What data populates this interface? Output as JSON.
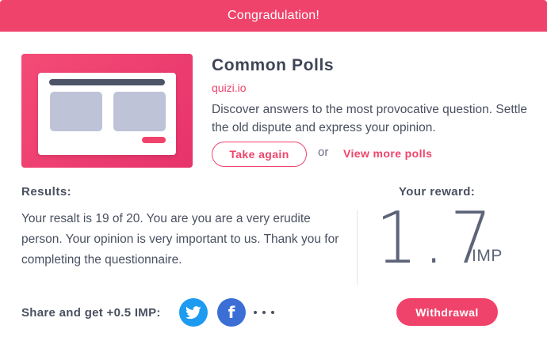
{
  "banner": {
    "text": "Congradulation!"
  },
  "poll": {
    "title": "Common Polls",
    "site": "quizi.io",
    "description": "Discover answers to the most provocative question. Settle the old dispute and express your opinion.",
    "take_again_label": "Take again",
    "or_text": "or",
    "view_more_label": "View more polls"
  },
  "results": {
    "heading": "Results:",
    "text": "Your resalt is 19 of 20. You are you are a very erudite person. Your opinion is very important to us. Thank you for completing the questionnaire."
  },
  "reward": {
    "heading": "Your reward:",
    "value": "1.7",
    "unit": "IMP"
  },
  "share": {
    "label": "Share and get +0.5 IMP:",
    "icons": [
      "twitter-icon",
      "facebook-icon",
      "more-icon"
    ],
    "facebook_glyph": "f"
  },
  "withdraw": {
    "label": "Withdrawal"
  },
  "colors": {
    "accent": "#f0436b",
    "text": "#4a5060",
    "twitter": "#1c9bf0",
    "facebook": "#3b6fd6",
    "thumbnail_blocks": "#bfc3d8"
  }
}
